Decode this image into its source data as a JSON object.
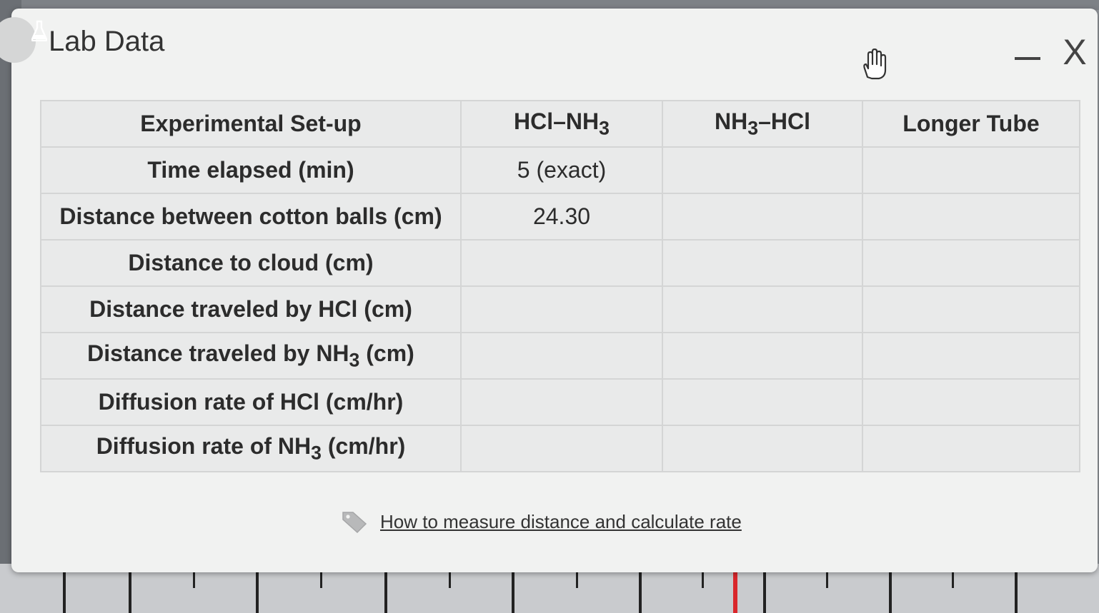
{
  "window": {
    "title": "Lab Data",
    "minimize_label": "–",
    "close_label": "X"
  },
  "icons": {
    "badge": "flask-icon",
    "cursor": "hand-icon",
    "help": "tag-icon"
  },
  "table": {
    "headers": [
      "Experimental Set-up",
      "HCl–NH3",
      "NH3–HCl",
      "Longer Tube"
    ],
    "rows": [
      {
        "label": "Time elapsed (min)",
        "values": [
          "5 (exact)",
          "",
          ""
        ]
      },
      {
        "label": "Distance between cotton balls (cm)",
        "values": [
          "24.30",
          "",
          ""
        ]
      },
      {
        "label": "Distance to cloud (cm)",
        "values": [
          "",
          "",
          ""
        ]
      },
      {
        "label": "Distance traveled by HCl (cm)",
        "values": [
          "",
          "",
          ""
        ]
      },
      {
        "label": "Distance traveled by NH3 (cm)",
        "values": [
          "",
          "",
          ""
        ]
      },
      {
        "label": "Diffusion rate of HCl (cm/hr)",
        "values": [
          "",
          "",
          ""
        ]
      },
      {
        "label": "Diffusion rate of NH3 (cm/hr)",
        "values": [
          "",
          "",
          ""
        ]
      }
    ]
  },
  "help": {
    "link_text": "How to measure distance and calculate rate"
  },
  "colors": {
    "dialog_bg": "#f1f2f1",
    "table_bg": "#e9eaea",
    "text": "#2c2c2c",
    "ruler_marker": "#d9262b"
  }
}
